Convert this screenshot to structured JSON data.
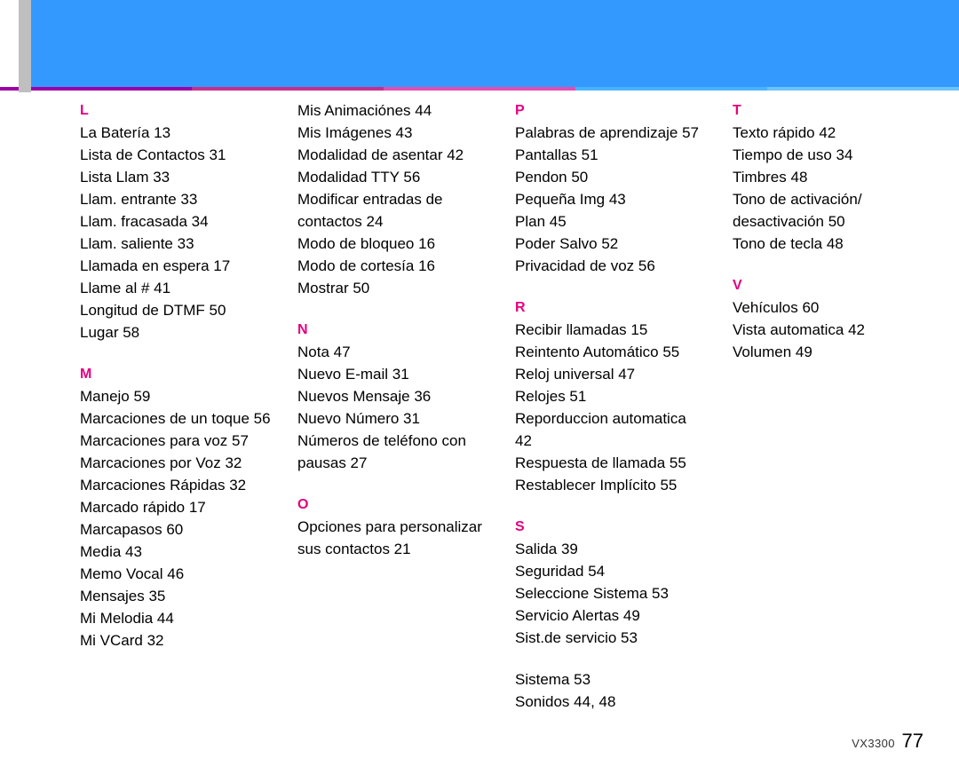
{
  "footer": {
    "model": "VX3300",
    "page": "77"
  },
  "m_continued": [
    "Mis Animaciónes 44",
    "Mis Imágenes 43",
    "Modalidad de asentar 42",
    "Modalidad TTY 56",
    "Modificar entradas de contactos 24",
    "Modo de bloqueo 16",
    "Modo de cortesía 16",
    "Mostrar 50"
  ],
  "s_continued": [
    "Sistema 53",
    "Sonidos 44, 48"
  ],
  "sections": [
    {
      "letter": "L",
      "items": [
        "La Batería 13",
        "Lista de Contactos 31",
        "Lista Llam 33",
        "Llam. entrante 33",
        "Llam. fracasada 34",
        "Llam. saliente 33",
        "Llamada en espera 17",
        "Llame al # 41",
        "Longitud de DTMF 50",
        "Lugar 58"
      ]
    },
    {
      "letter": "M",
      "items": [
        "Manejo 59",
        "Marcaciones de un toque 56",
        "Marcaciones para voz 57",
        "Marcaciones por Voz 32",
        "Marcaciones Rápidas 32",
        "Marcado rápido 17",
        "Marcapasos 60",
        "Media 43",
        "Memo Vocal 46",
        "Mensajes 35",
        "Mi Melodia 44",
        "Mi VCard 32"
      ]
    },
    {
      "letter": "N",
      "items": [
        "Nota 47",
        "Nuevo E-mail 31",
        "Nuevos Mensaje 36",
        "Nuevo Número 31",
        "Números de teléfono con pausas 27"
      ]
    },
    {
      "letter": "O",
      "items": [
        "Opciones para personalizar sus contactos 21"
      ]
    },
    {
      "letter": "P",
      "items": [
        "Palabras de aprendizaje 57",
        "Pantallas 51",
        "Pendon 50",
        "Pequeña Img 43",
        "Plan 45",
        "Poder Salvo 52",
        "Privacidad de voz 56"
      ]
    },
    {
      "letter": "R",
      "items": [
        "Recibir llamadas 15",
        "Reintento Automático 55",
        "Reloj universal 47",
        "Relojes 51",
        "Reporduccion automatica 42",
        "Respuesta de llamada 55",
        "Restablecer Implícito 55"
      ]
    },
    {
      "letter": "S",
      "items": [
        "Salida 39",
        "Seguridad 54",
        "Seleccione Sistema 53",
        "Servicio Alertas 49",
        "Sist.de servicio 53"
      ]
    },
    {
      "letter": "T",
      "items": [
        "Texto rápido 42",
        "Tiempo de uso 34",
        "Timbres 48",
        "Tono de activación/ desactivación 50",
        "Tono de tecla 48"
      ]
    },
    {
      "letter": "V",
      "items": [
        "Vehículos 60",
        "Vista automatica 42",
        "Volumen 49"
      ]
    }
  ]
}
